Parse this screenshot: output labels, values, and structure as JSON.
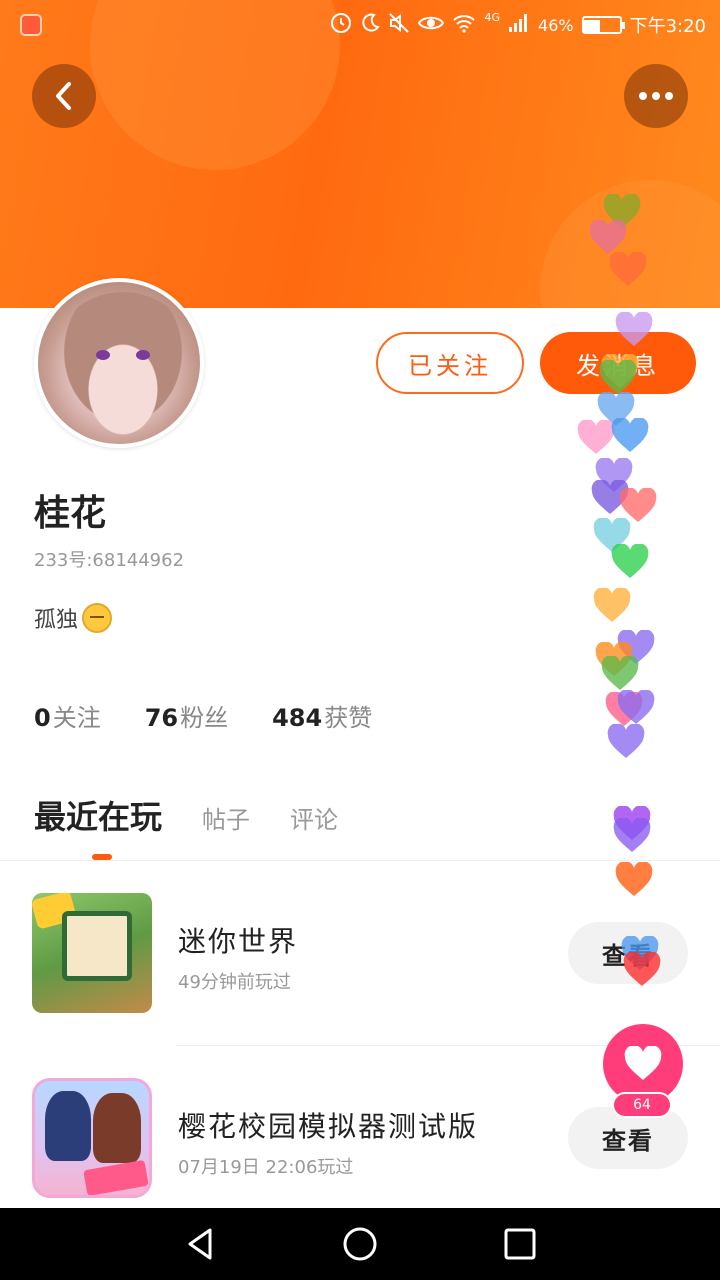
{
  "status_bar": {
    "network_label": "4G",
    "battery_text": "46%",
    "battery_level": 0.46,
    "time": "下午3:20"
  },
  "header": {
    "back_icon": "chevron-left-icon",
    "more_icon": "more-dots-icon"
  },
  "profile": {
    "follow_label": "已关注",
    "message_label": "发消息",
    "username": "桂花",
    "user_id": "233号:68144962",
    "bio": "孤独",
    "bio_emoji": "pensive-face-icon"
  },
  "stats": [
    {
      "num": "0",
      "label": "关注"
    },
    {
      "num": "76",
      "label": "粉丝"
    },
    {
      "num": "484",
      "label": "获赞"
    }
  ],
  "tabs": [
    {
      "label": "最近在玩"
    },
    {
      "label": "帖子"
    },
    {
      "label": "评论"
    }
  ],
  "games": [
    {
      "title": "迷你世界",
      "subtitle": "49分钟前玩过",
      "button": "查看"
    },
    {
      "title": "樱花校园模拟器测试版",
      "subtitle": "07月19日 22:06玩过",
      "button": "查看"
    }
  ],
  "like": {
    "count": "64",
    "accent": "#ff3d7a"
  },
  "colors": {
    "brand": "#ff6a10",
    "accent": "#ff5a0a"
  }
}
